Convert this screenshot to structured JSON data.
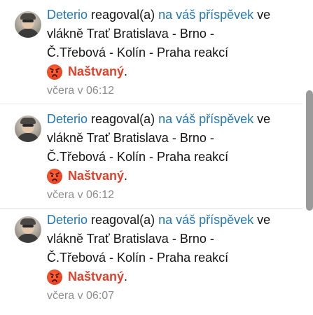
{
  "alerts": [
    {
      "user": "Deterio",
      "action": " reagoval(a) ",
      "link_text": "na váš příspěvek",
      "line1_rest": " ve",
      "line2": "vlákně Trať Bratislava - Brno -",
      "line3": "Č.Třebová - Kolín - Praha reakcí",
      "reaction_icon": "angry-face-emoji",
      "reaction": "Naštvaný",
      "reaction_suffix": ".",
      "time": "včera v 06:12"
    },
    {
      "user": "Deterio",
      "action": " reagoval(a) ",
      "link_text": "na váš příspěvek",
      "line1_rest": " ve",
      "line2": "vlákně Trať Bratislava - Brno -",
      "line3": "Č.Třebová - Kolín - Praha reakcí",
      "reaction_icon": "angry-face-emoji",
      "reaction": "Naštvaný",
      "reaction_suffix": ".",
      "time": "včera v 06:12"
    },
    {
      "user": "Deterio",
      "action": " reagoval(a) ",
      "link_text": "na váš příspěvek",
      "line1_rest": " ve",
      "line2": "vlákně Trať Bratislava - Brno -",
      "line3": "Č.Třebová - Kolín - Praha reakcí",
      "reaction_icon": "angry-face-emoji",
      "reaction": "Naštvaný",
      "reaction_suffix": ".",
      "time": "včera v 06:07"
    }
  ],
  "colors": {
    "link": "#2577b1",
    "reaction": "#e0412a",
    "time": "#8c8c8c",
    "scrollbar_thumb": "#9a9a9a"
  }
}
